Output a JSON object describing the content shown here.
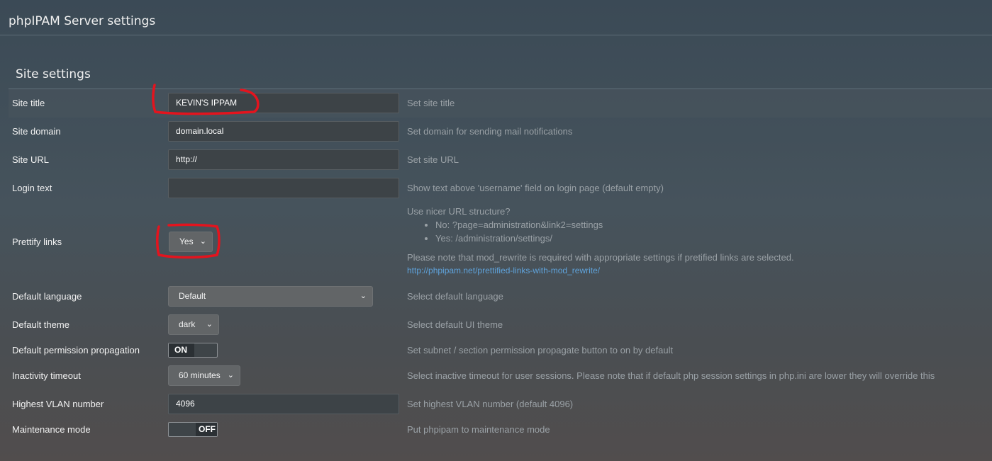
{
  "header": {
    "title": "phpIPAM Server settings"
  },
  "section": {
    "title": "Site settings"
  },
  "fields": {
    "site_title": {
      "label": "Site title",
      "value": "KEVIN'S IPPAM",
      "description": "Set site title"
    },
    "site_domain": {
      "label": "Site domain",
      "value": "domain.local",
      "description": "Set domain for sending mail notifications"
    },
    "site_url": {
      "label": "Site URL",
      "value": "http://",
      "description": "Set site URL"
    },
    "login_text": {
      "label": "Login text",
      "value": "",
      "description": "Show text above 'username' field on login page (default empty)"
    },
    "prettify_links": {
      "label": "Prettify links",
      "value": "Yes",
      "description_title": "Use nicer URL structure?",
      "options_list": [
        "No: ?page=administration&link2=settings",
        "Yes: /administration/settings/"
      ],
      "note": "Please note that mod_rewrite is required with appropriate settings if pretified links are selected.",
      "link": "http://phpipam.net/prettified-links-with-mod_rewrite/"
    },
    "default_language": {
      "label": "Default language",
      "value": "Default",
      "description": "Select default language"
    },
    "default_theme": {
      "label": "Default theme",
      "value": "dark",
      "description": "Select default UI theme"
    },
    "permission_propagation": {
      "label": "Default permission propagation",
      "state": "ON",
      "description": "Set subnet / section permission propagate button to on by default"
    },
    "inactivity_timeout": {
      "label": "Inactivity timeout",
      "value": "60 minutes",
      "description": "Select inactive timeout for user sessions. Please note that if default php session settings in php.ini are lower they will override this"
    },
    "highest_vlan": {
      "label": "Highest VLAN number",
      "value": "4096",
      "description": "Set highest VLAN number (default 4096)"
    },
    "maintenance_mode": {
      "label": "Maintenance mode",
      "state": "OFF",
      "description": "Put phpipam to maintenance mode"
    }
  },
  "colors": {
    "annotation": "#e3141e",
    "link": "#5fa3dc"
  },
  "icons": {
    "select_arrow": "chevron-down-icon"
  }
}
